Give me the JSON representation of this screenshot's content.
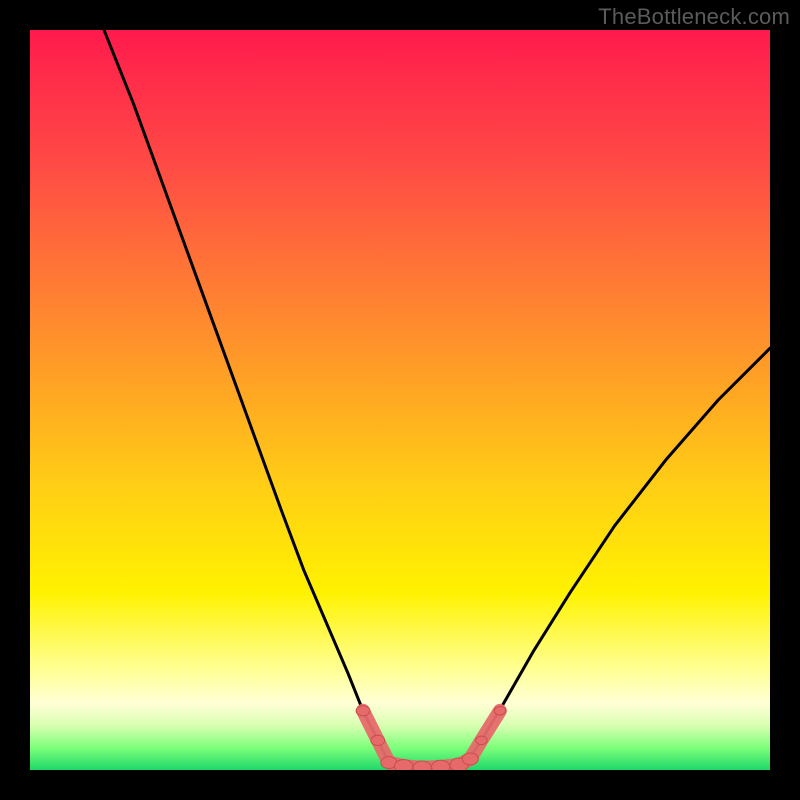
{
  "watermark": "TheBottleneck.com",
  "colors": {
    "background": "#000000",
    "curve": "#000000",
    "marker_fill": "#e66a6a",
    "marker_stroke": "#c74e4e",
    "gradient_top": "#ff1a4d",
    "gradient_bottom": "#1fd86a"
  },
  "chart_data": {
    "type": "line",
    "title": "",
    "xlabel": "",
    "ylabel": "",
    "xlim": [
      0,
      100
    ],
    "ylim": [
      0,
      100
    ],
    "grid": false,
    "legend": false,
    "series": [
      {
        "name": "left-curve",
        "x": [
          10,
          14,
          18,
          22,
          26,
          30,
          34,
          37,
          40,
          43,
          45,
          47,
          48.5
        ],
        "y": [
          100,
          90,
          79,
          68,
          57,
          46,
          35,
          27,
          20,
          13,
          8,
          4,
          1
        ]
      },
      {
        "name": "right-curve",
        "x": [
          59,
          61,
          64,
          68,
          73,
          79,
          86,
          93,
          100
        ],
        "y": [
          1,
          4,
          9,
          16,
          24,
          33,
          42,
          50,
          57
        ]
      },
      {
        "name": "flat-bottom",
        "x": [
          48.5,
          50,
          52,
          54,
          56,
          58,
          59
        ],
        "y": [
          1,
          0.5,
          0.3,
          0.3,
          0.4,
          0.7,
          1
        ]
      }
    ],
    "markers": {
      "name": "bottom-markers",
      "x": [
        45,
        47,
        48.5,
        50.5,
        53,
        55.5,
        58,
        59.5,
        61,
        63.5
      ],
      "y": [
        8,
        4,
        1,
        0.5,
        0.3,
        0.4,
        0.7,
        1.5,
        4,
        8
      ],
      "r": [
        6,
        6,
        7,
        8,
        8,
        8,
        8,
        7,
        5,
        5
      ]
    }
  }
}
